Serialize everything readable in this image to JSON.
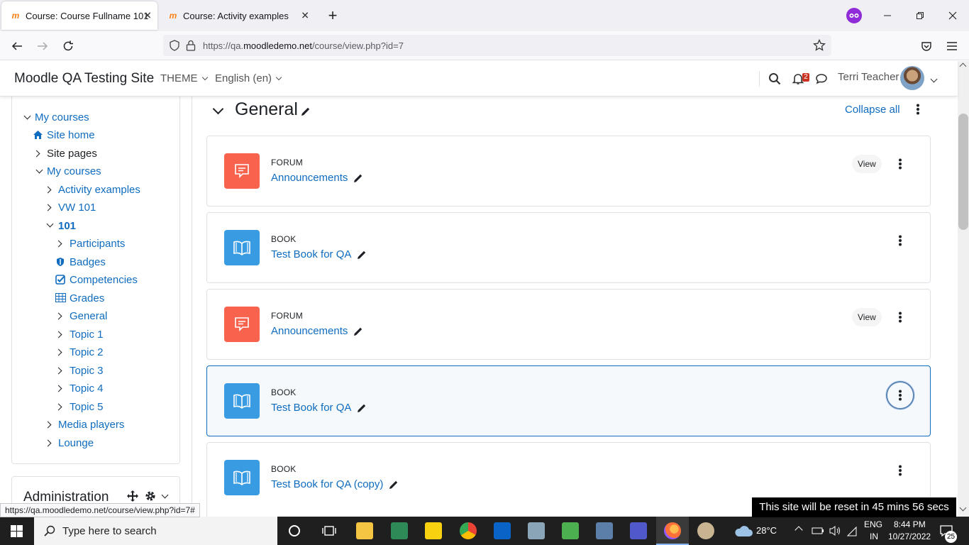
{
  "browser": {
    "tabs": [
      {
        "title": "Course: Course Fullname 101",
        "active": true
      },
      {
        "title": "Course: Activity examples",
        "active": false
      }
    ],
    "url": {
      "prefix": "https://qa.",
      "host": "moodledemo.net",
      "path": "/course/view.php?id=7"
    },
    "status_url": "https://qa.moodledemo.net/course/view.php?id=7#"
  },
  "header": {
    "site_name": "Moodle QA Testing Site",
    "theme_label": "THEME",
    "language_label": "English (en)",
    "notifications_count": "2",
    "user_name": "Terri Teacher"
  },
  "sidebar": {
    "items": [
      {
        "label": "My courses"
      },
      {
        "label": "Site home"
      },
      {
        "label": "Site pages"
      },
      {
        "label": "My courses"
      },
      {
        "label": "Activity examples"
      },
      {
        "label": "VW 101"
      },
      {
        "label": "101"
      },
      {
        "label": "Participants"
      },
      {
        "label": "Badges"
      },
      {
        "label": "Competencies"
      },
      {
        "label": "Grades"
      },
      {
        "label": "General"
      },
      {
        "label": "Topic 1"
      },
      {
        "label": "Topic 2"
      },
      {
        "label": "Topic 3"
      },
      {
        "label": "Topic 4"
      },
      {
        "label": "Topic 5"
      },
      {
        "label": "Media players"
      },
      {
        "label": "Lounge"
      }
    ],
    "admin_title": "Administration"
  },
  "main": {
    "section_title": "General",
    "collapse_label": "Collapse all",
    "view_label": "View",
    "activities": [
      {
        "type": "FORUM",
        "name": "Announcements"
      },
      {
        "type": "BOOK",
        "name": "Test Book for QA"
      },
      {
        "type": "FORUM",
        "name": "Announcements"
      },
      {
        "type": "BOOK",
        "name": "Test Book for QA"
      },
      {
        "type": "BOOK",
        "name": "Test Book for QA (copy)"
      }
    ]
  },
  "toast": "This site will be reset in 45 mins 56 secs",
  "taskbar": {
    "search_placeholder": "Type here to search",
    "temperature": "28°C",
    "lang_top": "ENG",
    "lang_bottom": "IN",
    "time": "8:44 PM",
    "date": "10/27/2022",
    "notification_count": "25"
  },
  "colors": {
    "link": "#0f6cbf",
    "forum": "#f7634d",
    "book": "#399be2",
    "accent_badge": "#ca3120"
  }
}
